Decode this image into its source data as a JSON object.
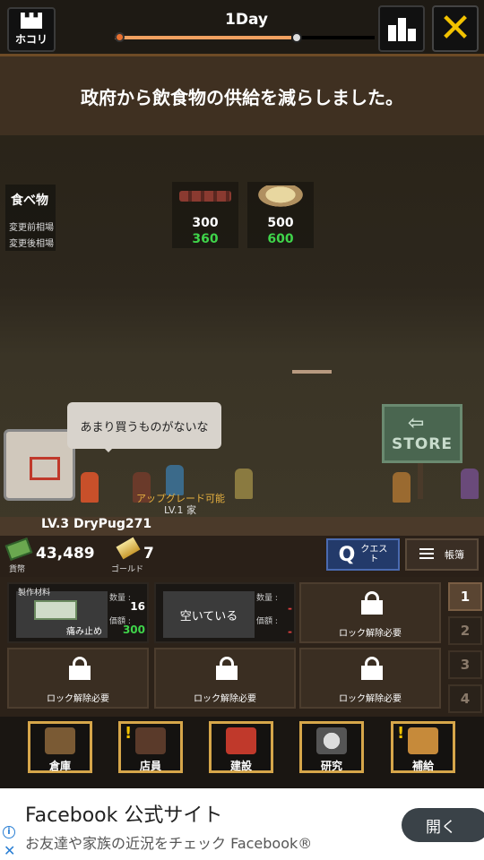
{
  "topbar": {
    "home_label": "ホコリ",
    "day_label": "1Day",
    "day_progress": 0.68
  },
  "banner": {
    "message": "政府から飲食物の供給を減らしました。"
  },
  "market": {
    "title": "食べ物",
    "before_label": "変更前相場",
    "after_label": "変更後相場",
    "items": [
      {
        "icon": "jerky-icon",
        "name": "干し肉",
        "before": "300",
        "after": "360"
      },
      {
        "icon": "ramen-bowl-icon",
        "name": "ラーメン大盛り",
        "before": "500",
        "after": "600"
      }
    ]
  },
  "scene": {
    "speech": "あまり買うものがないな",
    "upgrade_text": "アップグレード可能",
    "house_level": "LV.1 家",
    "player_level": "LV.3 DryPug271",
    "store_sign": "STORE"
  },
  "status": {
    "money_value": "43,489",
    "money_label": "貨幣",
    "gold_value": "7",
    "gold_label": "ゴールド",
    "quest_letter": "Q",
    "quest_label": "クエスト",
    "ledger_label": "帳簿"
  },
  "slots": {
    "material_tag": "製作材料",
    "material_name": "痛み止め",
    "qty_label": "数量 :",
    "price_label": "価額 :",
    "slot1_qty": "16",
    "slot1_price": "300",
    "empty_label": "空いている",
    "slot2_qty": "-",
    "slot2_price": "-",
    "lock_label": "ロック解除必要"
  },
  "pages": [
    "1",
    "2",
    "3",
    "4"
  ],
  "nav": {
    "warehouse": "倉庫",
    "staff": "店員",
    "build": "建設",
    "research": "研究",
    "supply": "補給"
  },
  "ad": {
    "title": "Facebook 公式サイト",
    "description": "お友達や家族の近況をチェック Facebook®",
    "button": "開く"
  },
  "colors": {
    "accent_gold": "#d6a64a",
    "price_up": "#3fd44a",
    "close_yellow": "#f2c200",
    "quest_blue": "#233a6a"
  }
}
